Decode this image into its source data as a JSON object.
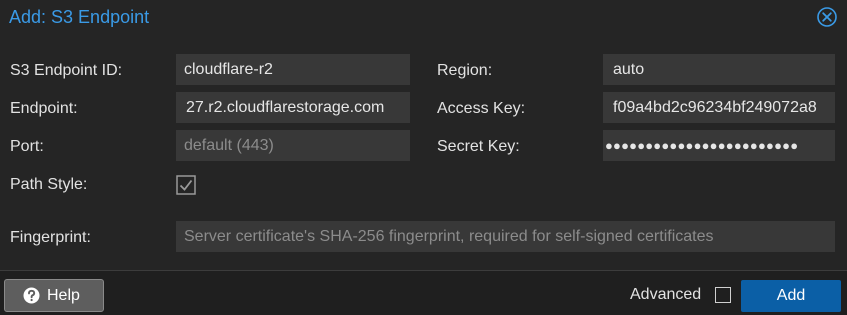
{
  "dialog": {
    "title": "Add: S3 Endpoint",
    "close_icon": "close-circle-icon"
  },
  "form": {
    "endpoint_id": {
      "label": "S3 Endpoint ID:",
      "value": "cloudflare-r2"
    },
    "endpoint": {
      "label": "Endpoint:",
      "value": "27.r2.cloudflarestorage.com"
    },
    "port": {
      "label": "Port:",
      "placeholder": "default (443)"
    },
    "path_style": {
      "label": "Path Style:",
      "checked": true
    },
    "region": {
      "label": "Region:",
      "value": "auto"
    },
    "access_key": {
      "label": "Access Key:",
      "value": "f09a4bd2c96234bf249072a8"
    },
    "secret_key": {
      "label": "Secret Key:",
      "masked": "●●●●●●●●●●●●●●●●●●●●●●●●"
    },
    "fingerprint": {
      "label": "Fingerprint:",
      "placeholder": "Server certificate's SHA-256 fingerprint, required for self-signed certificates"
    }
  },
  "footer": {
    "help_label": "Help",
    "help_icon": "question-circle-icon",
    "advanced_label": "Advanced",
    "advanced_checked": false,
    "add_label": "Add"
  },
  "colors": {
    "background": "#252525",
    "title": "#3a9ae6",
    "input": "#383838",
    "primary_button": "#0b5fa6"
  }
}
